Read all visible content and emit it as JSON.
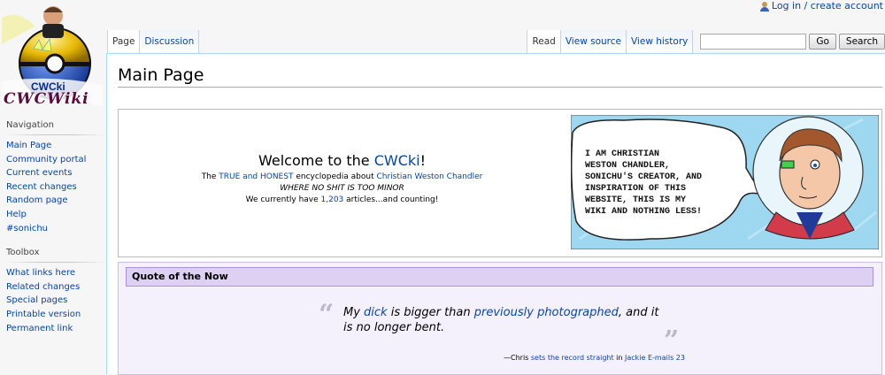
{
  "personal": {
    "login": "Log in / create account"
  },
  "logo": {
    "text": "CWCki",
    "banner": "CWCWiki"
  },
  "nav": {
    "left_tabs": [
      "Page",
      "Discussion"
    ],
    "right_tabs": [
      "Read",
      "View source",
      "View history"
    ],
    "search": {
      "placeholder": "",
      "go": "Go",
      "search": "Search"
    }
  },
  "sidebar": {
    "navigation": {
      "heading": "Navigation",
      "items": [
        "Main Page",
        "Community portal",
        "Current events",
        "Recent changes",
        "Random page",
        "Help",
        "#sonichu"
      ]
    },
    "toolbox": {
      "heading": "Toolbox",
      "items": [
        "What links here",
        "Related changes",
        "Special pages",
        "Printable version",
        "Permanent link"
      ]
    }
  },
  "page": {
    "title": "Main Page"
  },
  "welcome": {
    "prefix": "Welcome to the ",
    "link": "CWCki",
    "suffix": "!",
    "line1": {
      "pre": "The ",
      "link1": "TRUE and HONEST",
      "mid": " encyclopedia about ",
      "link2": "Christian Weston Chandler"
    },
    "motto": "WHERE NO SHIT IS TOO MINOR",
    "count": {
      "pre": "We currently have ",
      "num": "1,203",
      "post": " articles...and counting!"
    }
  },
  "comic": {
    "bubble": [
      "I AM CHRISTIAN",
      "WESTON CHANDLER,",
      "SONICHU'S CREATOR, AND",
      "INSPIRATION OF THIS",
      "WEBSITE, THIS IS MY",
      "WIKI AND NOTHING LESS!"
    ]
  },
  "quote": {
    "header": "Quote of the Now",
    "open_mark": "“",
    "close_mark": "”",
    "t1": "My ",
    "l1": "dick",
    "t2": " is bigger than ",
    "l2": "previously photographed",
    "t3": ", and it is no longer bent.",
    "attrib": {
      "dash": "—Chris ",
      "link1": "sets the record straight",
      "mid": " in ",
      "link2": "Jackie E-mails 23"
    }
  },
  "colors": {
    "link": "#0645ad",
    "quote_bg": "#f5f1fc",
    "quote_header": "#ddd0f2",
    "comic_sky": "#9ed8f0"
  }
}
